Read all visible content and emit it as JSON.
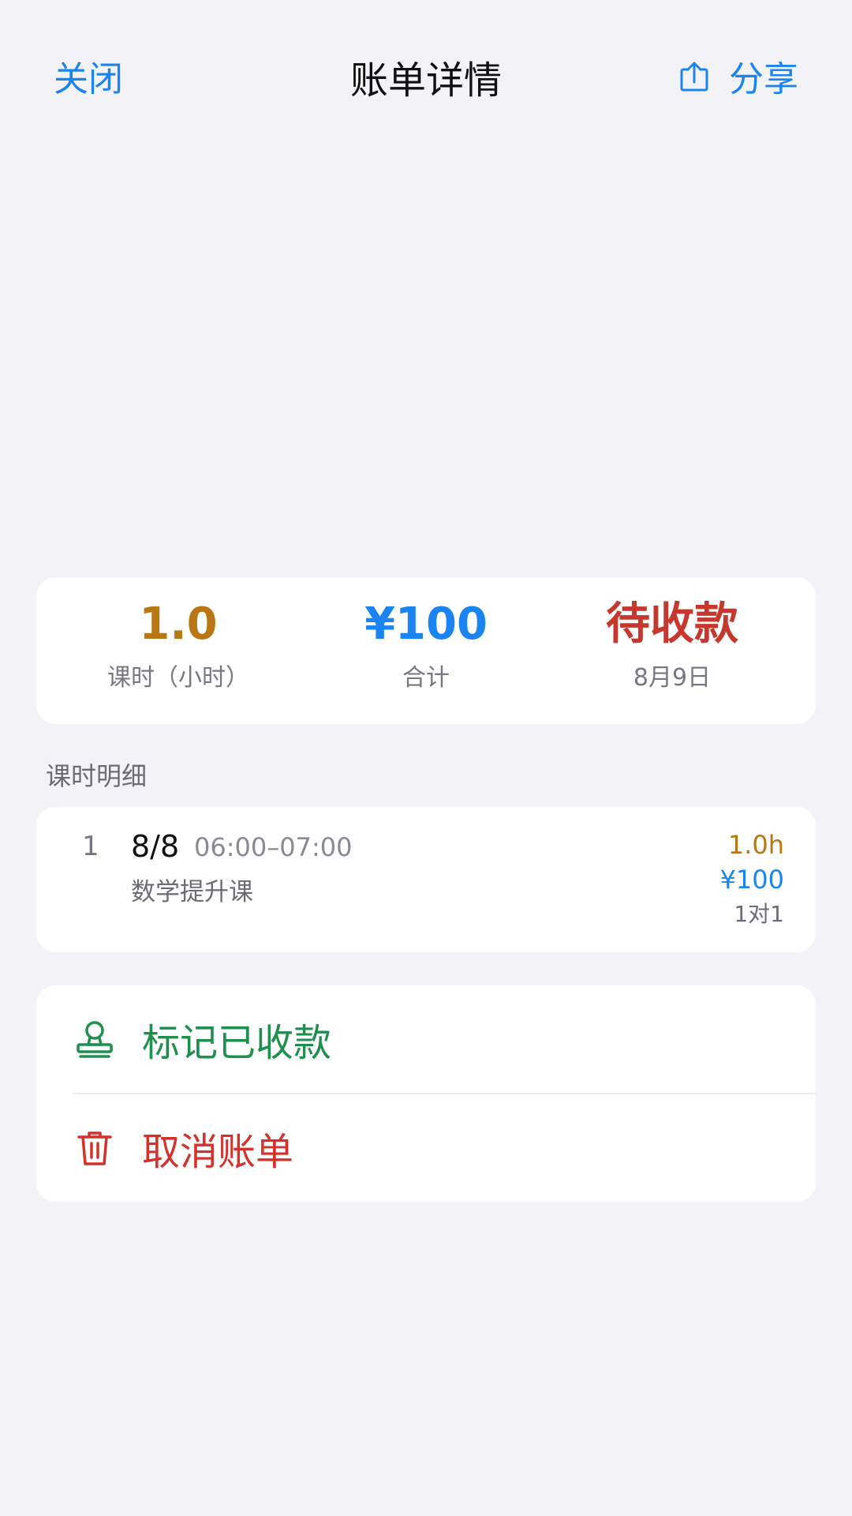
{
  "nav": {
    "close_label": "关闭",
    "title": "账单详情",
    "share_label": "分享"
  },
  "summary": {
    "hours_value": "1.0",
    "hours_label": "课时（小时）",
    "total_value": "¥100",
    "total_label": "合计",
    "status_value": "待收款",
    "status_date": "8月9日"
  },
  "section": {
    "title": "课时明细"
  },
  "lessons": [
    {
      "index": "1",
      "date": "8/8",
      "time": "06:00–07:00",
      "course": "数学提升课",
      "hours": "1.0h",
      "amount": "¥100",
      "type": "1对1"
    }
  ],
  "actions": {
    "mark_paid_label": "标记已收款",
    "cancel_label": "取消账单"
  },
  "colors": {
    "accent_blue": "#1a84f2",
    "hours_orange": "#b87712",
    "status_red": "#c8372d",
    "success_green": "#1f8f4e",
    "danger_red": "#d6302a",
    "background": "#f2f2f7"
  }
}
